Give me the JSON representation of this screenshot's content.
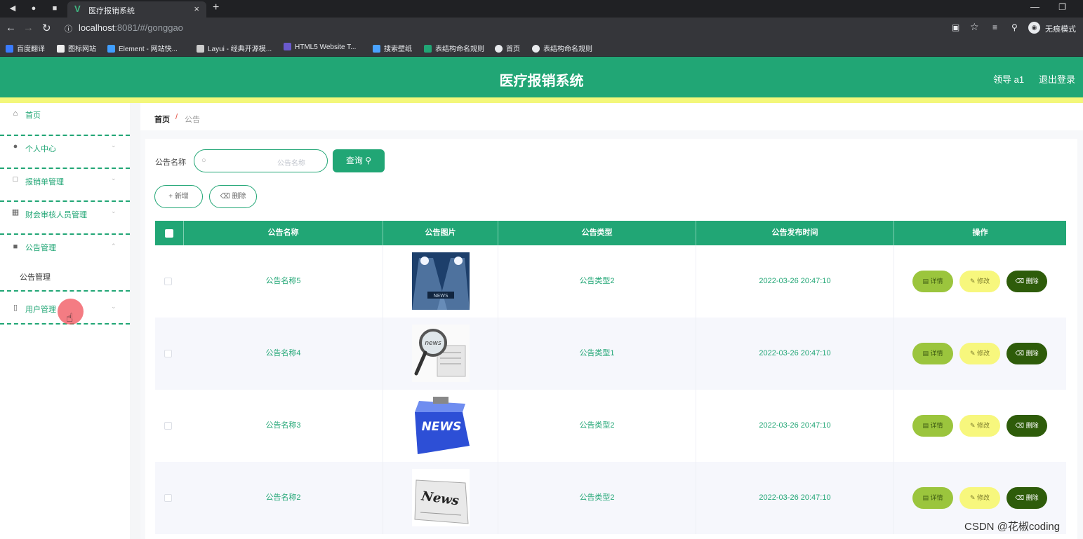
{
  "browser": {
    "tab_title": "医疗报销系统",
    "url_host": "localhost",
    "url_rest": ":8081/#/gonggao",
    "incognito_label": "无痕模式",
    "bookmarks": [
      "百度翻译",
      "图标网站",
      "Element - 网站快...",
      "Layui - 经典开源模...",
      "HTML5 Website T...",
      "搜索壁纸",
      "表结构命名规则",
      "首页",
      "表结构命名规则"
    ]
  },
  "header": {
    "title": "医疗报销系统",
    "user": "领导 a1",
    "logout": "退出登录",
    "color": "#21a675",
    "stripe_color": "#f3f77a"
  },
  "sidebar": {
    "items": [
      {
        "label": "首页",
        "icon": "home-icon"
      },
      {
        "label": "个人中心",
        "icon": "user-icon"
      },
      {
        "label": "报销单管理",
        "icon": "chat-icon"
      },
      {
        "label": "财会审核人员管理",
        "icon": "chart-icon"
      },
      {
        "label": "公告管理",
        "icon": "message-icon"
      },
      {
        "label": "用户管理",
        "icon": "phone-icon"
      }
    ],
    "sub_item": "公告管理"
  },
  "breadcrumb": {
    "home": "首页",
    "separator": "/",
    "current": "公告"
  },
  "search": {
    "label": "公告名称",
    "placeholder": "公告名称",
    "button": "查询"
  },
  "actions": {
    "add": "新增",
    "delete": "删除"
  },
  "table": {
    "columns": [
      "公告名称",
      "公告图片",
      "公告类型",
      "公告发布时间",
      "操作"
    ],
    "rows": [
      {
        "name": "公告名称5",
        "image": "spotlight-news",
        "type": "公告类型2",
        "time": "2022-03-26 20:47:10"
      },
      {
        "name": "公告名称4",
        "image": "magnifier-news",
        "type": "公告类型1",
        "time": "2022-03-26 20:47:10"
      },
      {
        "name": "公告名称3",
        "image": "news-key",
        "type": "公告类型2",
        "time": "2022-03-26 20:47:10"
      },
      {
        "name": "公告名称2",
        "image": "news-3d",
        "type": "公告类型2",
        "time": "2022-03-26 20:47:10"
      }
    ],
    "row_actions": {
      "detail": "详情",
      "edit": "修改",
      "delete": "删除"
    }
  },
  "watermark": "CSDN @花椒coding"
}
